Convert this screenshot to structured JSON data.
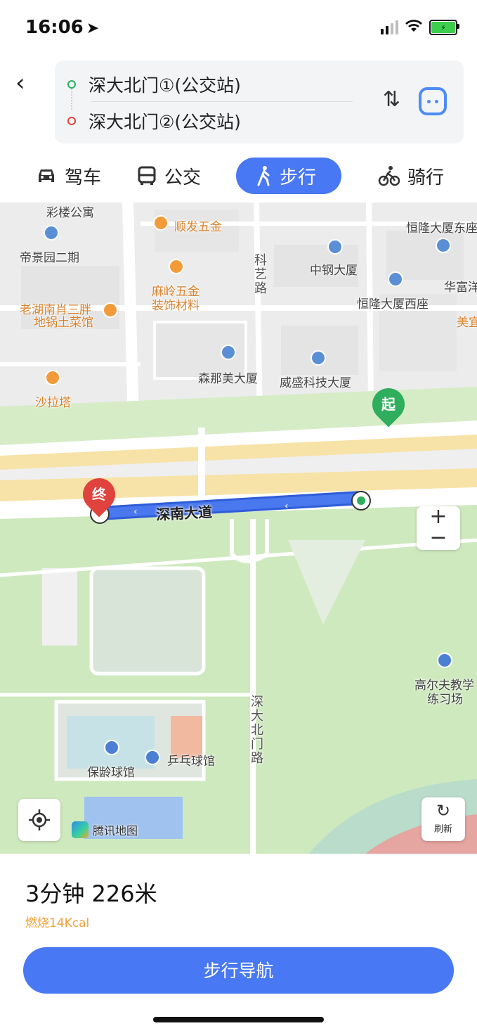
{
  "status_bar": {
    "time": "16:06",
    "location_arrow": "➤",
    "battery_icon": "battery-charging-icon",
    "battery_glyph": "⚡"
  },
  "route": {
    "back_glyph": "‹",
    "from": "深大北门①(公交站)",
    "to": "深大北门②(公交站)",
    "swap_glyph": "⇅"
  },
  "tabs": [
    {
      "label": "驾车",
      "icon": "car-icon"
    },
    {
      "label": "公交",
      "icon": "bus-icon"
    },
    {
      "label": "步行",
      "icon": "walk-icon",
      "active": true
    },
    {
      "label": "骑行",
      "icon": "bike-icon"
    }
  ],
  "map": {
    "pois": {
      "p1": "彩楼公寓",
      "p2": "顺发五金",
      "p3": "恒隆大厦东座",
      "p4": "帝景园二期",
      "p5": "中钢大厦",
      "p6": "华富洋",
      "p7": "麻岭五金",
      "p8": "装饰材料",
      "p9": "恒隆大厦西座",
      "p10": "老湖南肖三胖",
      "p11": "地锅土菜馆",
      "p12": "美宜",
      "p13": "森那美大厦",
      "p14": "威盛科技大厦",
      "p15": "沙拉塔",
      "p16": "高尔夫教学",
      "p17": "练习场",
      "p18": "保龄球馆",
      "p19": "乒乓球馆"
    },
    "roads": {
      "r1": "科艺路",
      "r2": "深南大道",
      "r3": "深大北门路"
    },
    "start_pin": "起",
    "end_pin": "终",
    "zoom_in": "+",
    "zoom_out": "−",
    "refresh_glyph": "↻",
    "refresh_label": "刷新",
    "brand": "腾讯地图",
    "colors": {
      "route": "#4a78ee",
      "highway": "#f7e3a8",
      "green": "#d4ecc4",
      "start_pin": "#2fae5d",
      "end_pin": "#e0433d"
    }
  },
  "summary": {
    "time_distance": "3分钟  226米",
    "calories": "燃烧14Kcal"
  },
  "nav_button": "步行导航"
}
